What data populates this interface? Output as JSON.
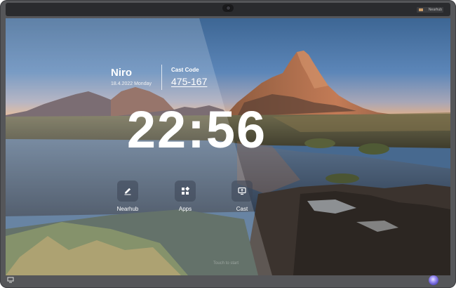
{
  "device": {
    "brand_text": "Nearhub"
  },
  "home": {
    "profile": {
      "name": "Niro",
      "date_day": "18.4.2022 Monday"
    },
    "cast": {
      "label": "Cast Code",
      "code": "475-167"
    },
    "clock": "22:56",
    "apps": [
      {
        "label": "Nearhub",
        "icon": "pencil-icon"
      },
      {
        "label": "Apps",
        "icon": "grid-icon"
      },
      {
        "label": "Cast",
        "icon": "cast-icon"
      }
    ],
    "hint": "Touch to start"
  },
  "colors": {
    "bezel": "#555659",
    "accent_button": "#6a5ae0",
    "text": "#ffffff"
  }
}
